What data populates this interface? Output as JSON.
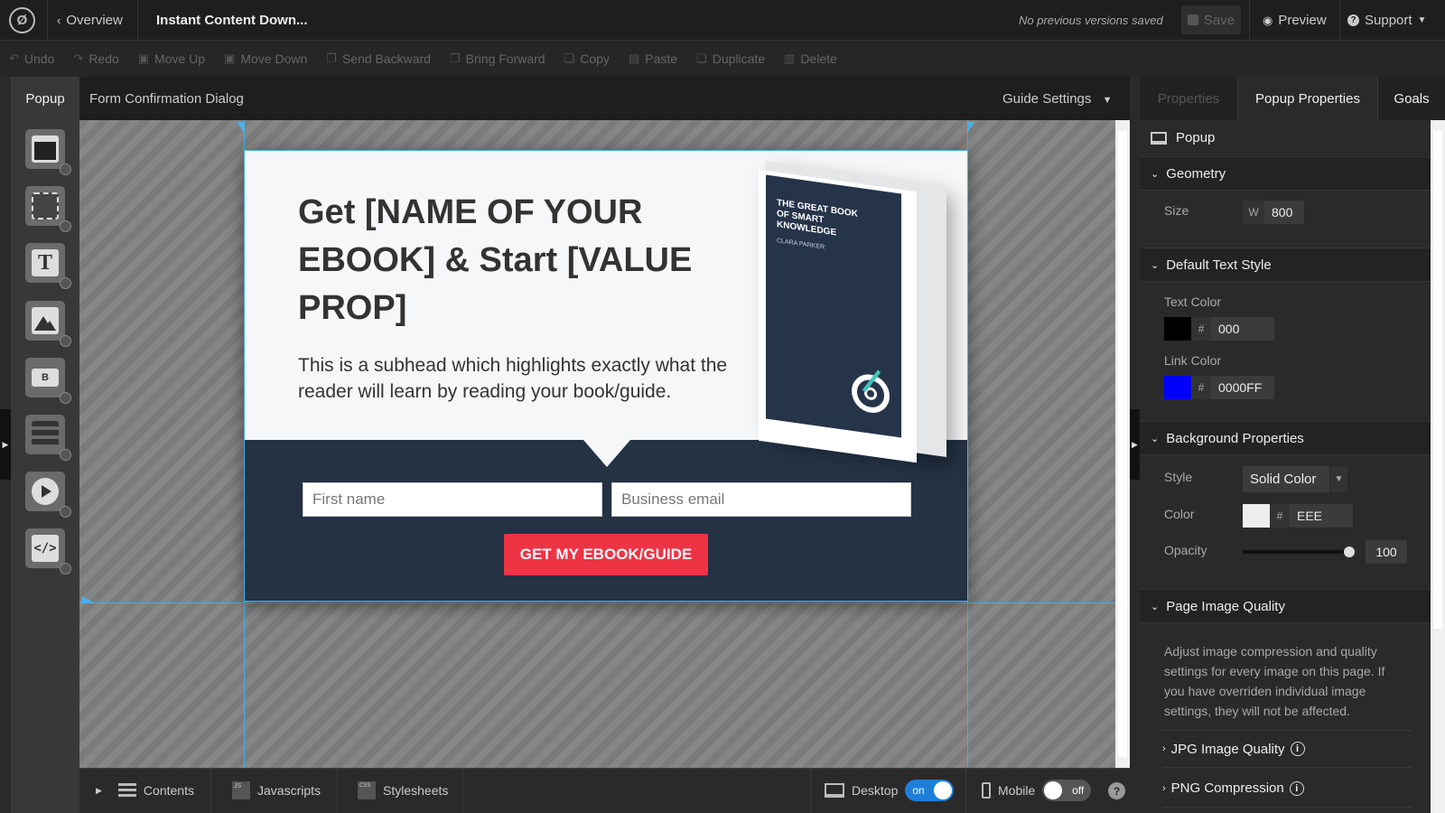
{
  "header": {
    "overview_label": "Overview",
    "page_title": "Instant Content Down...",
    "versions_text": "No previous versions saved",
    "save_label": "Save",
    "preview_label": "Preview",
    "support_label": "Support"
  },
  "toolbar": {
    "items": [
      "Undo",
      "Redo",
      "Move Up",
      "Move Down",
      "Send Backward",
      "Bring Forward",
      "Copy",
      "Paste",
      "Duplicate",
      "Delete"
    ]
  },
  "left_panel": {
    "tab_label": "Popup",
    "element_icons": [
      "section-icon",
      "box-icon",
      "text-icon",
      "image-icon",
      "button-icon",
      "form-icon",
      "video-icon",
      "code-icon"
    ]
  },
  "canvas": {
    "popup_name": "Form Confirmation Dialog",
    "guide_settings_label": "Guide Settings"
  },
  "popup": {
    "headline": "Get [NAME OF YOUR EBOOK] & Start [VALUE PROP]",
    "subhead": "This is a subhead which highlights exactly what the reader will learn by reading your book/guide.",
    "first_name_placeholder": "First name",
    "email_placeholder": "Business email",
    "cta_label": "GET MY EBOOK/GUIDE",
    "book_title": "THE GREAT BOOK OF SMART KNOWLEDGE",
    "book_author": "CLARA PARKER",
    "colors": {
      "band": "#243244",
      "cta": "#ee3345",
      "background": "#f6f7f8"
    }
  },
  "bottom_bar": {
    "contents_label": "Contents",
    "javascripts_label": "Javascripts",
    "stylesheets_label": "Stylesheets",
    "desktop_label": "Desktop",
    "desktop_toggle": "on",
    "mobile_label": "Mobile",
    "mobile_toggle": "off"
  },
  "right_panel": {
    "tabs": [
      "Properties",
      "Popup Properties",
      "Goals"
    ],
    "active_tab": "Popup Properties",
    "element_label": "Popup",
    "geometry": {
      "title": "Geometry",
      "size_label": "Size",
      "w_label": "W",
      "width": "800"
    },
    "text_style": {
      "title": "Default Text Style",
      "text_color_label": "Text Color",
      "text_color": "000",
      "link_color_label": "Link Color",
      "link_color": "0000FF",
      "text_swatch": "#000000",
      "link_swatch": "#0000ff"
    },
    "background": {
      "title": "Background Properties",
      "style_label": "Style",
      "style_value": "Solid Color",
      "color_label": "Color",
      "color_value": "EEE",
      "color_swatch": "#eeeeee",
      "opacity_label": "Opacity",
      "opacity_value": "100"
    },
    "image_quality": {
      "title": "Page Image Quality",
      "description": "Adjust image compression and quality settings for every image on this page. If you have overriden individual image settings, they will not be affected.",
      "jpg_label": "JPG Image Quality",
      "png_label": "PNG Compression"
    }
  }
}
